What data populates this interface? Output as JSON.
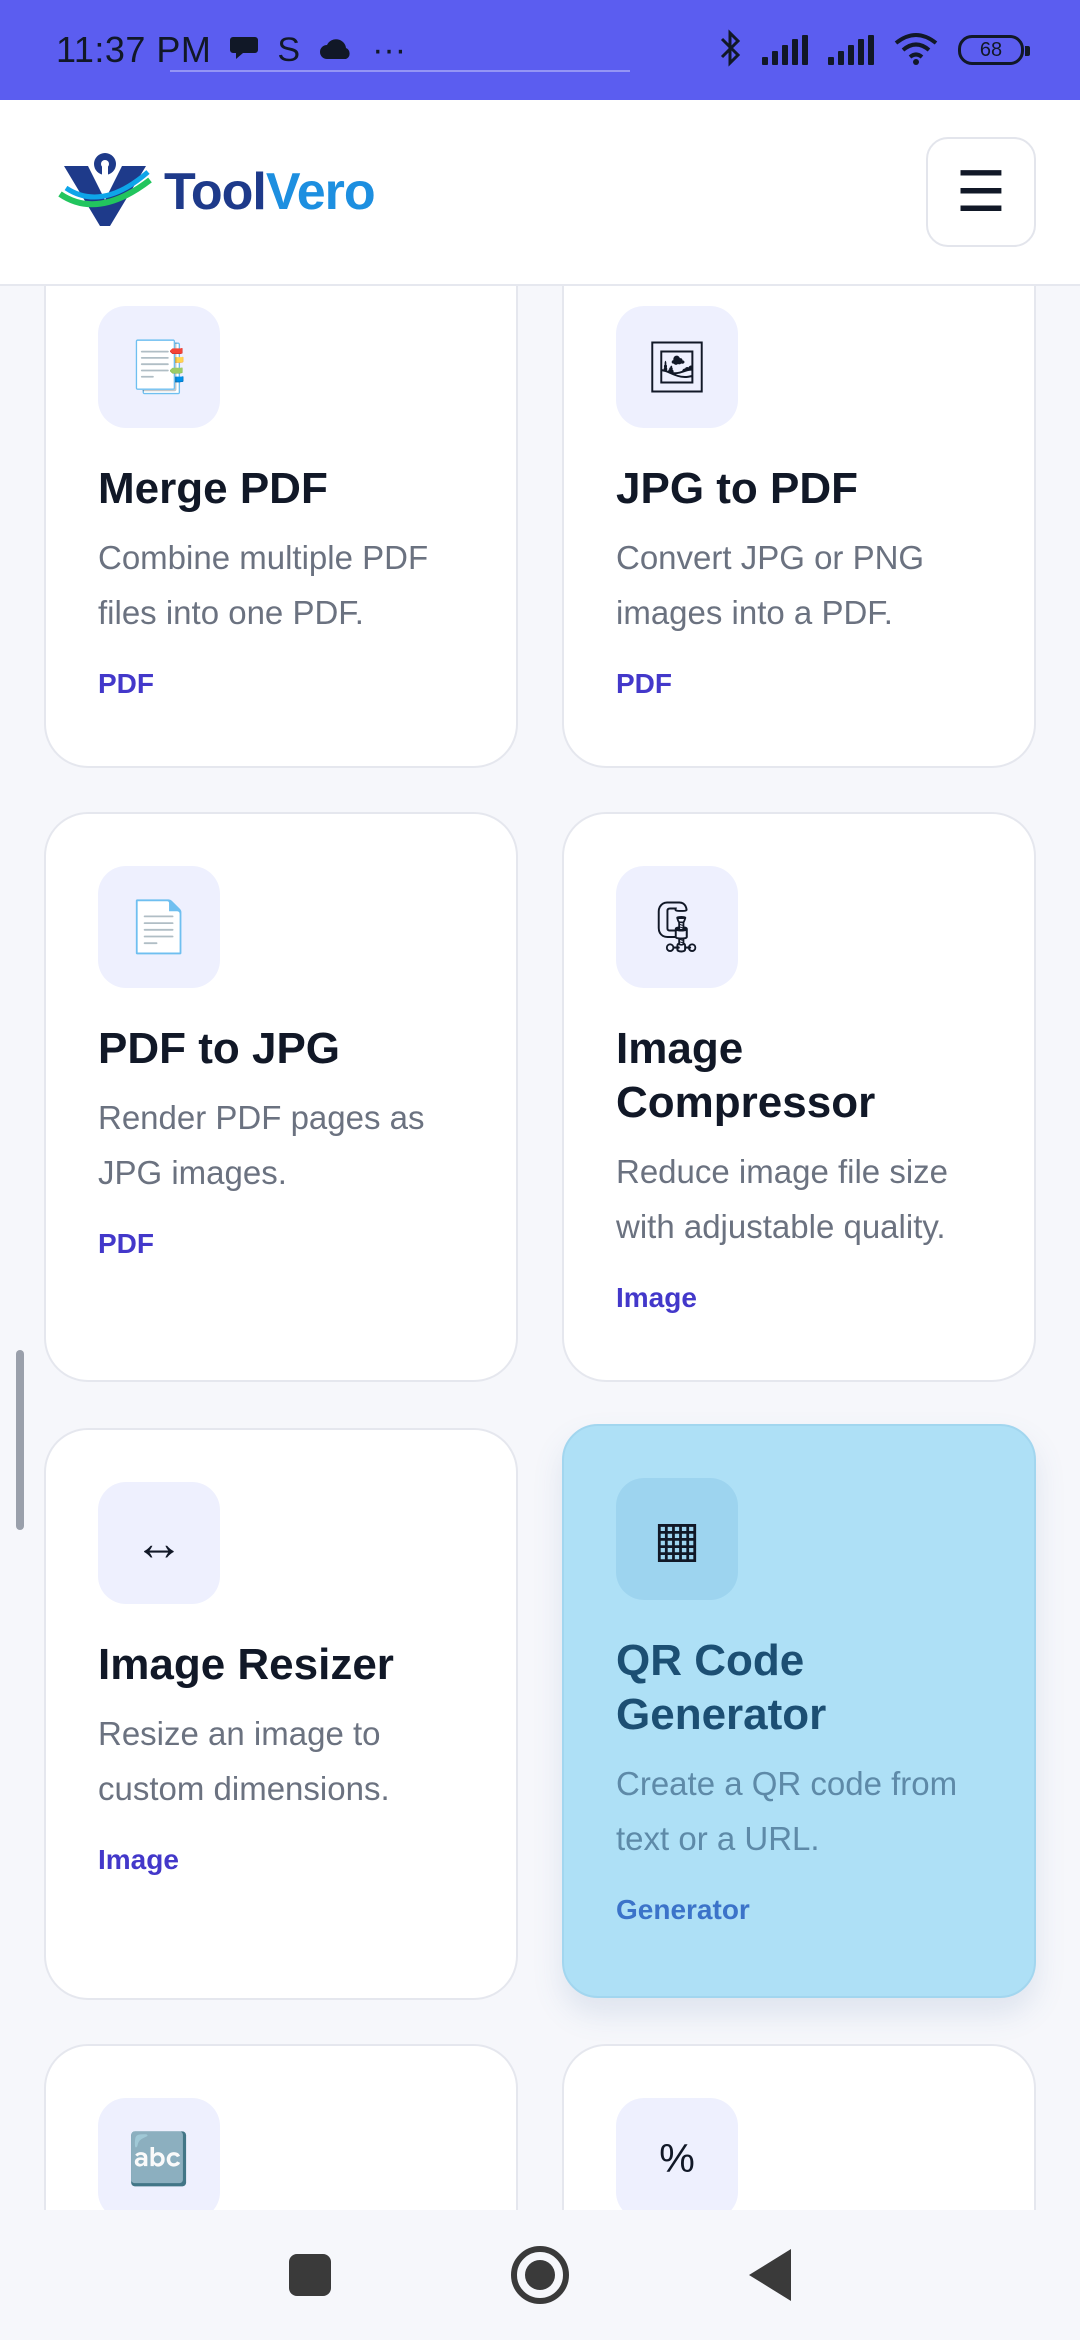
{
  "status_bar": {
    "time": "11:37 PM",
    "left_icons": [
      "chat-bubble-icon",
      "s-app-icon",
      "cloud-icon",
      "more-dots-icon"
    ],
    "battery_level": "68"
  },
  "header": {
    "logo_part1": "Tool",
    "logo_part2": "Vero",
    "menu_glyph": "☰"
  },
  "tools": [
    {
      "title": "Merge PDF",
      "description": "Combine multiple PDF files into one PDF.",
      "tag": "PDF",
      "icon": "📑",
      "icon_name": "document-tabs-icon"
    },
    {
      "title": "JPG to PDF",
      "description": "Convert JPG or PNG images into a PDF.",
      "tag": "PDF",
      "icon": "🖼",
      "icon_name": "framed-picture-icon"
    },
    {
      "title": "PDF to JPG",
      "description": "Render PDF pages as JPG images.",
      "tag": "PDF",
      "icon": "📄",
      "icon_name": "page-icon"
    },
    {
      "title": "Image Compressor",
      "description": "Reduce image file size with adjustable quality.",
      "tag": "Image",
      "icon": "🗜",
      "icon_name": "clamp-icon"
    },
    {
      "title": "Image Resizer",
      "description": "Resize an image to custom dimensions.",
      "tag": "Image",
      "icon": "↔",
      "icon_name": "left-right-arrow-icon"
    },
    {
      "title": "QR Code Generator",
      "description": "Create a QR code from text or a URL.",
      "tag": "Generator",
      "icon": "▦",
      "icon_name": "grid-icon"
    },
    {
      "title": "",
      "description": "",
      "tag": "",
      "icon": "🔤",
      "icon_name": "abc-icon"
    },
    {
      "title": "",
      "description": "",
      "tag": "",
      "icon": "%",
      "icon_name": "percent-icon"
    }
  ],
  "colors": {
    "status_bar": "#5b5df0",
    "tag": "#4338ca",
    "highlight_card": "#aee0f6"
  }
}
